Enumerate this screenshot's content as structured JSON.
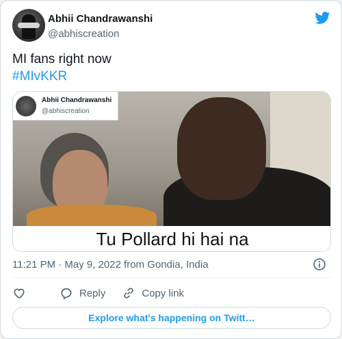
{
  "colors": {
    "accent": "#1d9bf0",
    "muted": "#536471",
    "border": "#cfd9de"
  },
  "author": {
    "name": "Abhii Chandrawanshi",
    "handle": "@abhiscreation"
  },
  "tweet": {
    "text": "MI fans right now",
    "hashtag": "#MIvKKR"
  },
  "media": {
    "quote_name": "Abhii Chandrawanshi",
    "quote_handle": "@abhiscreation",
    "caption": "Tu Pollard hi hai na"
  },
  "meta": {
    "timestamp": "11:21 PM · May 9, 2022 from Gondia, India"
  },
  "icons": {
    "logo": "twitter-bird-icon",
    "info": "info-icon",
    "like": "heart-icon",
    "reply": "reply-icon",
    "copy": "link-icon"
  },
  "actions": {
    "reply": "Reply",
    "copy_link": "Copy link"
  },
  "explore": {
    "label": "Explore what's happening on Twitt…"
  }
}
